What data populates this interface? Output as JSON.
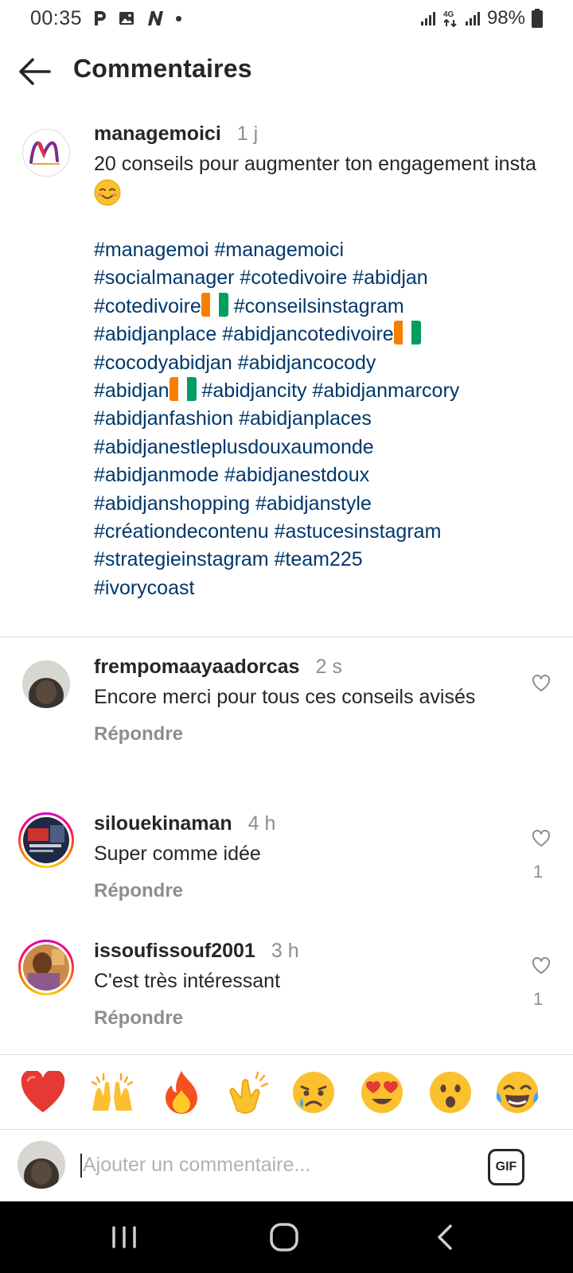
{
  "status_bar": {
    "time": "00:35",
    "battery": "98%",
    "network": "4G",
    "icons": [
      "parking-notification-icon",
      "gallery-icon",
      "news-icon",
      "more-dot-icon",
      "signal-icon",
      "signal-4g-icon",
      "signal-icon",
      "battery-icon"
    ]
  },
  "header": {
    "title": "Commentaires",
    "back_icon": "arrow-left-icon"
  },
  "caption": {
    "username": "managemoici",
    "time": "1 j",
    "text": "20 conseils pour augmenter ton engagement insta",
    "emoji": "smiling-face-icon",
    "hashtags": {
      "line1": "#managemoi #managemoici",
      "line2": "#socialmanager #cotedivoire #abidjan",
      "line3a": "#cotedivoire",
      "line3b": "#conseilsinstagram",
      "line4a": "#abidjanplace #abidjancotedivoire",
      "line5": "#cocodyabidjan #abidjancocody",
      "line6a": "#abidjan",
      "line6b": "#abidjancity #abidjanmarcory",
      "line7": "#abidjanfashion #abidjanplaces",
      "line8": "#abidjanestleplusdouxaumonde",
      "line9": "#abidjanmode #abidjanestdoux",
      "line10": "#abidjanshopping #abidjanstyle",
      "line11": "#créationdecontenu #astucesinstagram",
      "line12": "#strategieinstagram #team225",
      "line13": "#ivorycoast"
    }
  },
  "comments": [
    {
      "username": "frempomaayaadorcas",
      "time": "2 s",
      "text": "Encore merci pour tous ces conseils avisés",
      "reply": "Répondre",
      "likes": ""
    },
    {
      "username": "silouekinaman",
      "time": "4 h",
      "text": "Super comme idée",
      "reply": "Répondre",
      "likes": "1"
    },
    {
      "username": "issoufissouf2001",
      "time": "3 h",
      "text": "C'est très intéressant",
      "reply": "Répondre",
      "likes": "1"
    }
  ],
  "emoji_bar": [
    "red-heart-icon",
    "raising-hands-icon",
    "fire-icon",
    "clapping-hands-icon",
    "crying-face-icon",
    "heart-eyes-icon",
    "surprised-face-icon",
    "tears-of-joy-icon"
  ],
  "input": {
    "placeholder": "Ajouter un commentaire...",
    "gif_label": "GIF"
  },
  "nav": [
    "recent-apps-icon",
    "home-icon",
    "back-icon"
  ],
  "colors": {
    "hashtag": "#00376b",
    "secondary_text": "#8e8e8e",
    "primary_text": "#262626",
    "flag_orange": "#f77f00",
    "flag_green": "#009e60"
  }
}
